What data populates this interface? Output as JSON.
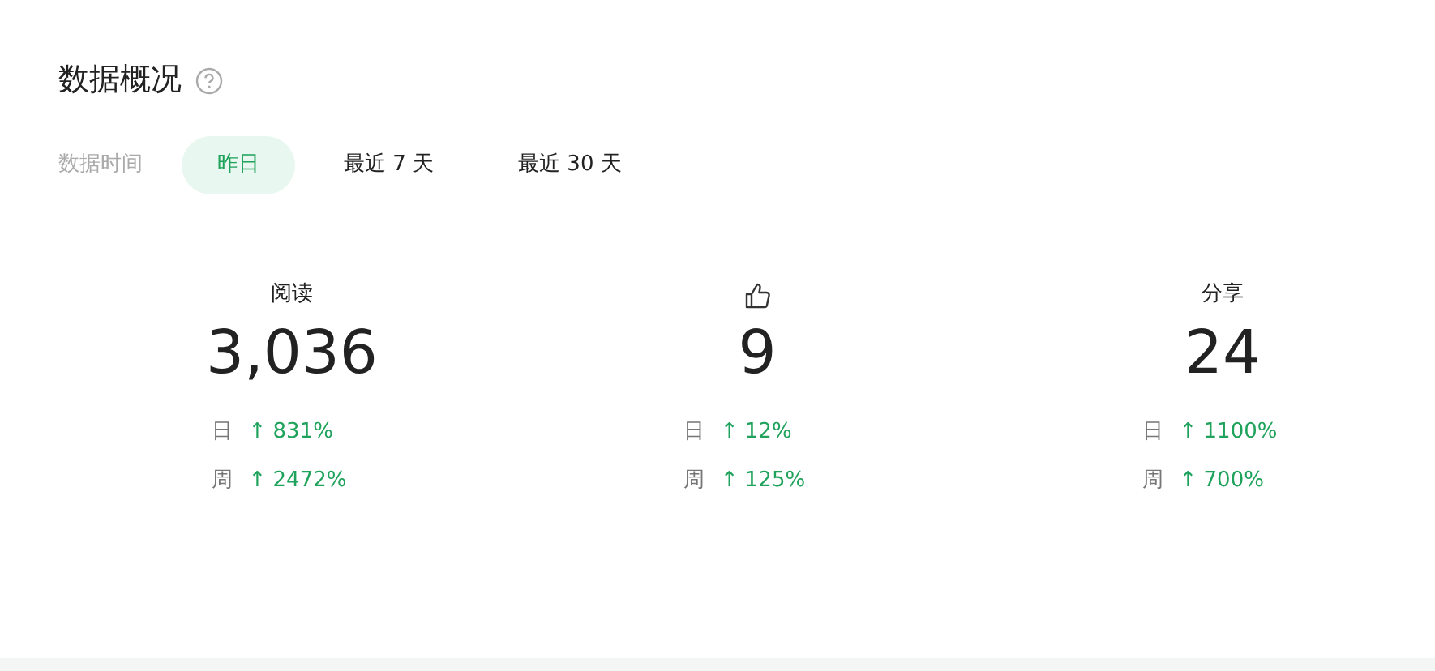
{
  "title": "数据概况",
  "range": {
    "label": "数据时间",
    "options": [
      {
        "label": "昨日",
        "selected": true
      },
      {
        "label": "最近 7 天",
        "selected": false
      },
      {
        "label": "最近 30 天",
        "selected": false
      }
    ]
  },
  "stats": [
    {
      "kind": "text",
      "label": "阅读",
      "value": "3,036",
      "changes": [
        {
          "label": "日",
          "value": "↑ 831%"
        },
        {
          "label": "周",
          "value": "↑ 2472%"
        }
      ]
    },
    {
      "kind": "icon",
      "value": "9",
      "changes": [
        {
          "label": "日",
          "value": "↑ 12%"
        },
        {
          "label": "周",
          "value": "↑ 125%"
        }
      ]
    },
    {
      "kind": "text",
      "label": "分享",
      "value": "24",
      "changes": [
        {
          "label": "日",
          "value": "↑ 1100%"
        },
        {
          "label": "周",
          "value": "↑ 700%"
        }
      ]
    }
  ]
}
